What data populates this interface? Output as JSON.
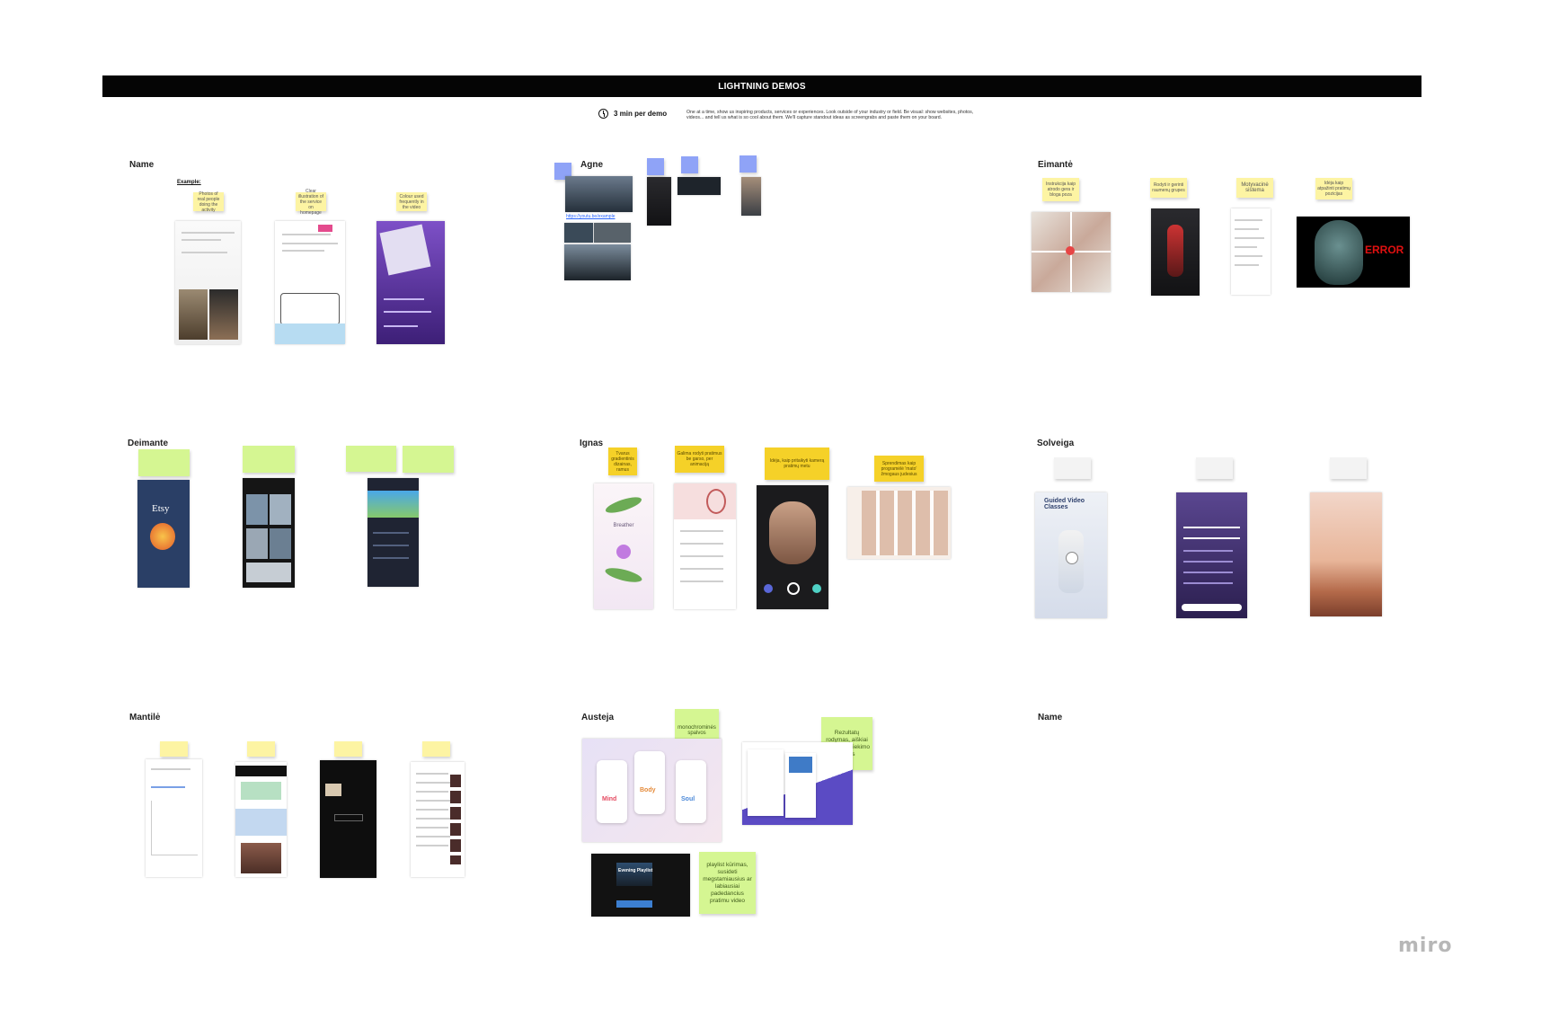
{
  "banner": {
    "title": "LIGHTNING DEMOS"
  },
  "timer": {
    "label": "3 min per demo",
    "icon": "clock-icon"
  },
  "instructions": "One at a time, show us inspiring products, services or experiences. Look outside of your industry or field. Be visual: show websites, photos, videos... and tell us what is so cool about them. We'll capture standout ideas as screengrabs and paste them on your board.",
  "sections": {
    "name_top": {
      "label": "Name",
      "example": "Example:",
      "stickies": [
        "Photos of real people doing the activity",
        "Clear illustration of the service on homepage",
        "Colour used frequently in the video"
      ]
    },
    "agne": {
      "label": "Agne",
      "link": "https://youtu.be/example"
    },
    "eimante": {
      "label": "Eimantė",
      "stickies": [
        "Instrukcija kaip atrodo gera ir bloga poza",
        "Rodyti ir gerinti raumenų grupes",
        "Motyvacinė sistema",
        "Idėja kaip atpažinti pratimų pozicijas"
      ],
      "error_text": "ERROR"
    },
    "deimante": {
      "label": "Deimante",
      "etsy": "Etsy"
    },
    "ignas": {
      "label": "Ignas",
      "stickies": [
        "Tvarus gradientinis dizainas, ramus",
        "Galima rodyti pratimus be garso, per animaciją",
        "Idėja, kaip pritaikyti kamerą pratimų metu",
        "Sprendimas kaip programėlė 'mato' žmogaus judesius"
      ],
      "app_title": "Breather"
    },
    "solveiga": {
      "label": "Solveiga",
      "app_title": "Guided Video Classes"
    },
    "mantile": {
      "label": "Mantilė"
    },
    "austeja": {
      "label": "Austeja",
      "stickies": [
        "monochrominės spalvos",
        "Rezultatų rodymas, aiškiai išreikštas siekimo tikslas",
        "playlist kūrimas, susideti megstamiausius ar labiausiai padedancius pratimu video"
      ],
      "cards": [
        "Mind",
        "Body",
        "Soul"
      ],
      "playlist": "Evening Playlist"
    },
    "name_bottom": {
      "label": "Name"
    }
  },
  "footer": {
    "brand": "miro"
  },
  "colors": {
    "banner": "#050505",
    "sticky_yellow": "#fdf4a3",
    "sticky_orange": "#f5d128",
    "sticky_green": "#d5f692",
    "sticky_blue": "#8fa3f7"
  }
}
